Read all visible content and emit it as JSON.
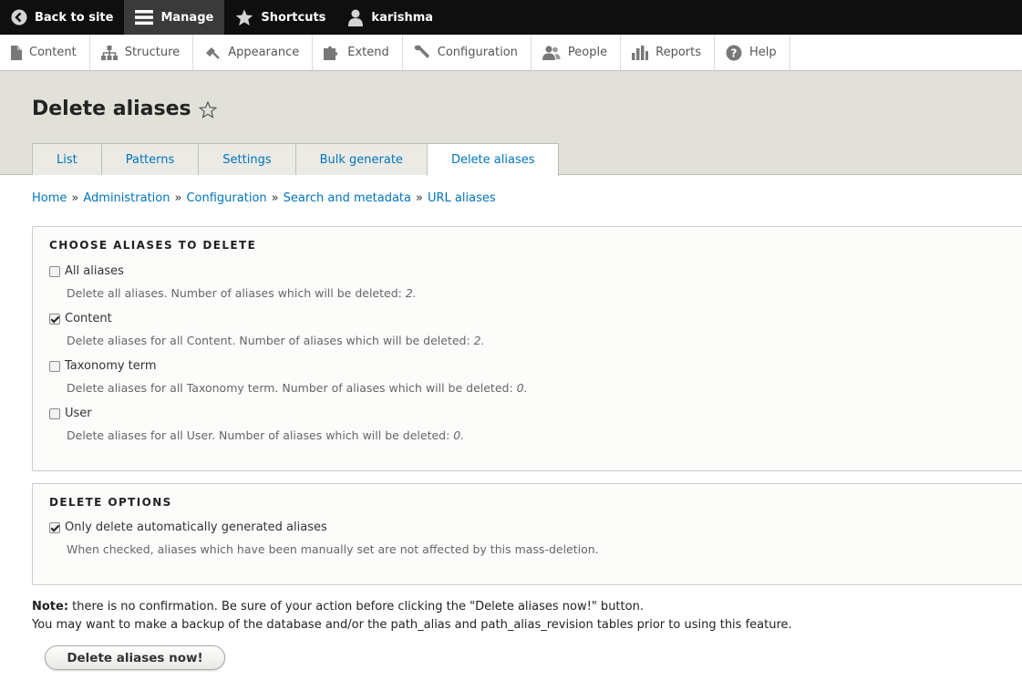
{
  "toolbar": {
    "back_label": "Back to site",
    "manage_label": "Manage",
    "shortcuts_label": "Shortcuts",
    "user_label": "karishma"
  },
  "tray": {
    "items": [
      "Content",
      "Structure",
      "Appearance",
      "Extend",
      "Configuration",
      "People",
      "Reports",
      "Help"
    ]
  },
  "header": {
    "title": "Delete aliases",
    "tabs": [
      "List",
      "Patterns",
      "Settings",
      "Bulk generate",
      "Delete aliases"
    ],
    "active_tab": "Delete aliases"
  },
  "breadcrumb": {
    "items": [
      "Home",
      "Administration",
      "Configuration",
      "Search and metadata",
      "URL aliases"
    ],
    "separator": "»"
  },
  "choose": {
    "legend": "Choose aliases to delete",
    "options": [
      {
        "label": "All aliases",
        "checked": false,
        "desc": "Delete all aliases. Number of aliases which will be deleted: ",
        "count": "2."
      },
      {
        "label": "Content",
        "checked": true,
        "desc": "Delete aliases for all Content. Number of aliases which will be deleted: ",
        "count": "2."
      },
      {
        "label": "Taxonomy term",
        "checked": false,
        "desc": "Delete aliases for all Taxonomy term. Number of aliases which will be deleted: ",
        "count": "0."
      },
      {
        "label": "User",
        "checked": false,
        "desc": "Delete aliases for all User. Number of aliases which will be deleted: ",
        "count": "0."
      }
    ]
  },
  "delete_options": {
    "legend": "Delete options",
    "option_label": "Only delete automatically generated aliases",
    "option_checked": true,
    "option_desc": "When checked, aliases which have been manually set are not affected by this mass-deletion."
  },
  "note": {
    "bold": "Note:",
    "line1": " there is no confirmation. Be sure of your action before clicking the \"Delete aliases now!\" button.",
    "line2": "You may want to make a backup of the database and/or the path_alias and path_alias_revision tables prior to using this feature."
  },
  "submit_label": "Delete aliases now!"
}
